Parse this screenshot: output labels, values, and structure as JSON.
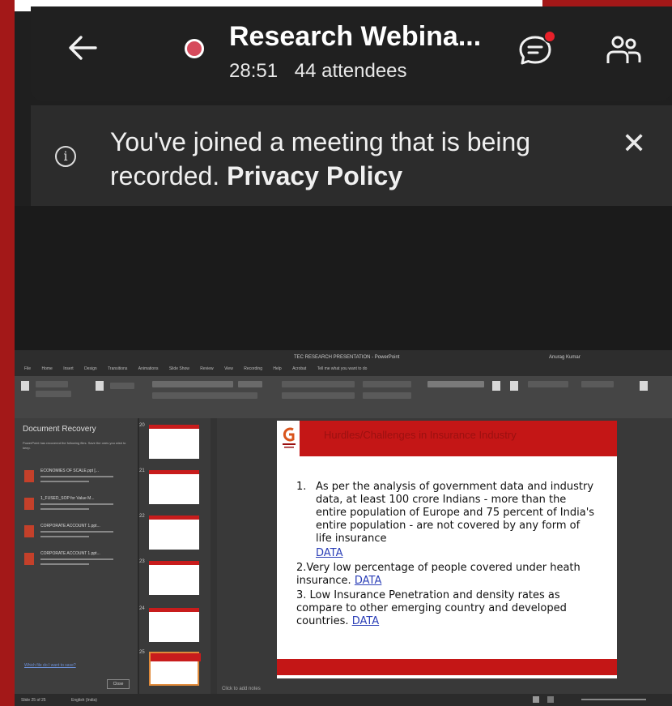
{
  "meeting": {
    "title": "Research Webina...",
    "elapsed": "28:51",
    "attendees": "44 attendees"
  },
  "banner": {
    "message": "You've joined a meeting that is being recorded.",
    "link": "Privacy Policy"
  },
  "ppt": {
    "window_title": "TEC RESEARCH PRESENTATION - PowerPoint",
    "user": "Anurag Kumar",
    "menu": [
      "File",
      "Home",
      "Insert",
      "Design",
      "Transitions",
      "Animations",
      "Slide Show",
      "Review",
      "View",
      "Recording",
      "Help",
      "Acrobat",
      "Tell me what you want to do"
    ],
    "recovery_title": "Document Recovery",
    "recovery_sub": "PowerPoint has recovered the following files. Save the ones you wish to keep.",
    "recovered": [
      {
        "name": "ECONOMIES OF SCALE.ppt [..."
      },
      {
        "name": "1_FUSED_SOP for Value M..."
      },
      {
        "name": "CORPORATE ACCOUNT 1.ppt..."
      },
      {
        "name": "CORPORATE ACCOUNT 1.ppt..."
      }
    ],
    "which_file": "Which file do I want to save?",
    "close_label": "Close",
    "thumb_numbers": [
      "20",
      "21",
      "22",
      "23",
      "24",
      "25"
    ],
    "notes_hint": "Click to add notes",
    "slide_heading": "Hurdles/Challenges in Insurance Industry",
    "point1": "As per the analysis of government data and industry data, at least 100 crore Indians - more than the entire population of Europe and 75 percent of India's entire population - are not covered by any form of life insurance",
    "point1_num": "1.",
    "point2": "2.Very low percentage of people covered under heath insurance.",
    "point3": "3. Low Insurance Penetration and density rates as compare to other emerging country and developed countries.",
    "data_link": "DATA",
    "status_slide": "Slide 25 of 25",
    "status_lang": "English (India)"
  }
}
